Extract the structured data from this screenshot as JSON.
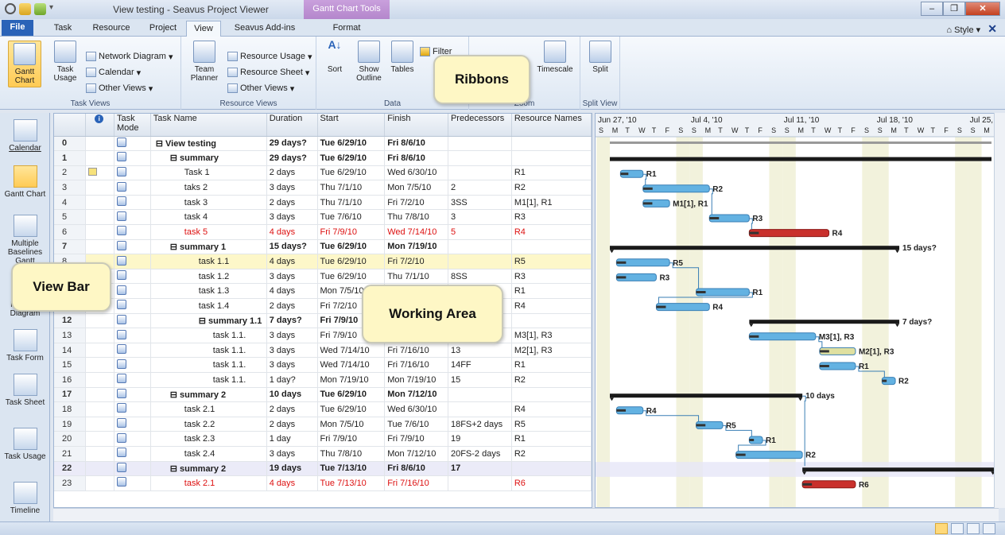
{
  "window": {
    "title": "View testing - Seavus Project Viewer",
    "context_tab": "Gantt Chart Tools",
    "help_label": "Style"
  },
  "tabs": [
    "File",
    "Task",
    "Resource",
    "Project",
    "View",
    "Seavus Add-ins",
    "Format"
  ],
  "ribbon": {
    "groups": [
      {
        "label": "Task Views",
        "big": [
          {
            "label": "Gantt Chart",
            "selected": true
          },
          {
            "label": "Task Usage"
          }
        ],
        "small": [
          "Network Diagram",
          "Calendar",
          "Other Views"
        ]
      },
      {
        "label": "Resource Views",
        "big": [
          {
            "label": "Team Planner"
          }
        ],
        "small": [
          "Resource Usage",
          "Resource Sheet",
          "Other Views"
        ]
      },
      {
        "label": "Data",
        "big": [
          {
            "label": "Sort"
          },
          {
            "label": "Show Outline"
          },
          {
            "label": "Tables"
          }
        ],
        "small": [
          "Filter"
        ]
      },
      {
        "label": "Zoom",
        "big": [
          {
            "label": "Timescale"
          }
        ],
        "small": []
      },
      {
        "label": "Split View",
        "big": [
          {
            "label": "Split"
          }
        ],
        "small": []
      }
    ]
  },
  "view_bar": [
    "Calendar",
    "Gantt Chart",
    "Multiple Baselines Gantt",
    "Network Diagram",
    "Task Form",
    "Task Sheet",
    "Task Usage",
    "Timeline"
  ],
  "columns": [
    "",
    "Task Mode",
    "Task Name",
    "Duration",
    "Start",
    "Finish",
    "Predecessors",
    "Resource Names"
  ],
  "rows": [
    {
      "id": "0",
      "name": "View testing",
      "duration": "29 days?",
      "start": "Tue 6/29/10",
      "finish": "Fri 8/6/10",
      "pred": "",
      "res": "",
      "lvl": 0,
      "summary": true,
      "style": "bold"
    },
    {
      "id": "1",
      "name": "summary",
      "duration": "29 days?",
      "start": "Tue 6/29/10",
      "finish": "Fri 8/6/10",
      "pred": "",
      "res": "",
      "lvl": 1,
      "summary": true
    },
    {
      "id": "2",
      "name": "Task 1",
      "duration": "2 days",
      "start": "Tue 6/29/10",
      "finish": "Wed 6/30/10",
      "pred": "",
      "res": "R1",
      "lvl": 2
    },
    {
      "id": "3",
      "name": "taks 2",
      "duration": "3 days",
      "start": "Thu 7/1/10",
      "finish": "Mon 7/5/10",
      "pred": "2",
      "res": "R2",
      "lvl": 2
    },
    {
      "id": "4",
      "name": "task 3",
      "duration": "2 days",
      "start": "Thu 7/1/10",
      "finish": "Fri 7/2/10",
      "pred": "3SS",
      "res": "M1[1], R1",
      "lvl": 2
    },
    {
      "id": "5",
      "name": "task 4",
      "duration": "3 days",
      "start": "Tue 7/6/10",
      "finish": "Thu 7/8/10",
      "pred": "3",
      "res": "R3",
      "lvl": 2
    },
    {
      "id": "6",
      "name": "task 5",
      "duration": "4 days",
      "start": "Fri 7/9/10",
      "finish": "Wed 7/14/10",
      "pred": "5",
      "res": "R4",
      "lvl": 2,
      "style": "red"
    },
    {
      "id": "7",
      "name": "summary 1",
      "duration": "15 days?",
      "start": "Tue 6/29/10",
      "finish": "Mon 7/19/10",
      "pred": "",
      "res": "",
      "lvl": 1,
      "summary": true
    },
    {
      "id": "8",
      "name": "task 1.1",
      "duration": "4 days",
      "start": "Tue 6/29/10",
      "finish": "Fri 7/2/10",
      "pred": "",
      "res": "R5",
      "lvl": 3,
      "style": "sel"
    },
    {
      "id": "9",
      "name": "task 1.2",
      "duration": "3 days",
      "start": "Tue 6/29/10",
      "finish": "Thu 7/1/10",
      "pred": "8SS",
      "res": "R3",
      "lvl": 3
    },
    {
      "id": "10",
      "name": "task 1.3",
      "duration": "4 days",
      "start": "Mon 7/5/10",
      "finish": "",
      "pred": "",
      "res": "R1",
      "lvl": 3
    },
    {
      "id": "11",
      "name": "task 1.4",
      "duration": "2 days",
      "start": "Fri 7/2/10",
      "finish": "",
      "pred": "",
      "res": "R4",
      "lvl": 3
    },
    {
      "id": "12",
      "name": "summary 1.1",
      "duration": "7 days?",
      "start": "Fri 7/9/10",
      "finish": "",
      "pred": "",
      "res": "",
      "lvl": 3,
      "summary": true
    },
    {
      "id": "13",
      "name": "task 1.1.",
      "duration": "3 days",
      "start": "Fri 7/9/10",
      "finish": "Tue 7/13/10",
      "pred": "",
      "res": "M3[1], R3",
      "lvl": 4
    },
    {
      "id": "14",
      "name": "task 1.1.",
      "duration": "3 days",
      "start": "Wed 7/14/10",
      "finish": "Fri 7/16/10",
      "pred": "13",
      "res": "M2[1], R3",
      "lvl": 4
    },
    {
      "id": "15",
      "name": "task 1.1.",
      "duration": "3 days",
      "start": "Wed 7/14/10",
      "finish": "Fri 7/16/10",
      "pred": "14FF",
      "res": "R1",
      "lvl": 4
    },
    {
      "id": "16",
      "name": "task 1.1.",
      "duration": "1 day?",
      "start": "Mon 7/19/10",
      "finish": "Mon 7/19/10",
      "pred": "15",
      "res": "R2",
      "lvl": 4
    },
    {
      "id": "17",
      "name": "summary 2",
      "duration": "10 days",
      "start": "Tue 6/29/10",
      "finish": "Mon 7/12/10",
      "pred": "",
      "res": "",
      "lvl": 1,
      "summary": true
    },
    {
      "id": "18",
      "name": "task 2.1",
      "duration": "2 days",
      "start": "Tue 6/29/10",
      "finish": "Wed 6/30/10",
      "pred": "",
      "res": "R4",
      "lvl": 2
    },
    {
      "id": "19",
      "name": "task 2.2",
      "duration": "2 days",
      "start": "Mon 7/5/10",
      "finish": "Tue 7/6/10",
      "pred": "18FS+2 days",
      "res": "R5",
      "lvl": 2
    },
    {
      "id": "20",
      "name": "task 2.3",
      "duration": "1 day",
      "start": "Fri 7/9/10",
      "finish": "Fri 7/9/10",
      "pred": "19",
      "res": "R1",
      "lvl": 2
    },
    {
      "id": "21",
      "name": "task 2.4",
      "duration": "3 days",
      "start": "Thu 7/8/10",
      "finish": "Mon 7/12/10",
      "pred": "20FS-2 days",
      "res": "R2",
      "lvl": 2
    },
    {
      "id": "22",
      "name": "summary 2",
      "duration": "19 days",
      "start": "Tue 7/13/10",
      "finish": "Fri 8/6/10",
      "pred": "17",
      "res": "",
      "lvl": 1,
      "summary": true,
      "style": "hl"
    },
    {
      "id": "23",
      "name": "task 2.1",
      "duration": "4 days",
      "start": "Tue 7/13/10",
      "finish": "Fri 7/16/10",
      "pred": "",
      "res": "R6",
      "lvl": 2,
      "style": "red"
    }
  ],
  "gantt": {
    "weeks": [
      "Jun 27, '10",
      "Jul 4, '10",
      "Jul 11, '10",
      "Jul 18, '10",
      "Jul 25,"
    ],
    "days": [
      "S",
      "M",
      "T",
      "W",
      "T",
      "F",
      "S"
    ],
    "bars": [
      {
        "row": 2,
        "start": 0.8,
        "end": 2.5,
        "kind": "task",
        "label": "R1"
      },
      {
        "row": 3,
        "start": 2.5,
        "end": 7.5,
        "kind": "task",
        "label": "R2"
      },
      {
        "row": 4,
        "start": 2.5,
        "end": 4.5,
        "kind": "task",
        "label": "M1[1], R1"
      },
      {
        "row": 5,
        "start": 7.5,
        "end": 10.5,
        "kind": "task",
        "label": "R3"
      },
      {
        "row": 6,
        "start": 10.5,
        "end": 16.5,
        "kind": "crit",
        "label": "R4"
      },
      {
        "row": 7,
        "start": 0,
        "end": 21.8,
        "kind": "summary",
        "label": "15 days?"
      },
      {
        "row": 8,
        "start": 0.5,
        "end": 4.5,
        "kind": "task",
        "label": "R5"
      },
      {
        "row": 9,
        "start": 0.5,
        "end": 3.5,
        "kind": "task",
        "label": "R3"
      },
      {
        "row": 10,
        "start": 6.5,
        "end": 10.5,
        "kind": "task",
        "label": "R1"
      },
      {
        "row": 11,
        "start": 3.5,
        "end": 7.5,
        "kind": "task",
        "label": "R4"
      },
      {
        "row": 12,
        "start": 10.5,
        "end": 21.8,
        "kind": "summary",
        "label": "7 days?"
      },
      {
        "row": 13,
        "start": 10.5,
        "end": 15.5,
        "kind": "task",
        "label": "M3[1], R3"
      },
      {
        "row": 14,
        "start": 15.8,
        "end": 18.5,
        "kind": "manual",
        "label": "M2[1], R3"
      },
      {
        "row": 15,
        "start": 15.8,
        "end": 18.5,
        "kind": "task",
        "label": "R1"
      },
      {
        "row": 16,
        "start": 20.5,
        "end": 21.5,
        "kind": "task",
        "label": "R2"
      },
      {
        "row": 17,
        "start": 0,
        "end": 14.5,
        "kind": "summary",
        "label": "10 days"
      },
      {
        "row": 18,
        "start": 0.5,
        "end": 2.5,
        "kind": "task",
        "label": "R4"
      },
      {
        "row": 19,
        "start": 6.5,
        "end": 8.5,
        "kind": "task",
        "label": "R5"
      },
      {
        "row": 20,
        "start": 10.5,
        "end": 11.5,
        "kind": "task",
        "label": "R1"
      },
      {
        "row": 21,
        "start": 9.5,
        "end": 14.5,
        "kind": "task",
        "label": "R2"
      },
      {
        "row": 22,
        "start": 14.5,
        "end": 29,
        "kind": "summary",
        "label": ""
      },
      {
        "row": 23,
        "start": 14.5,
        "end": 18.5,
        "kind": "crit",
        "label": "R6"
      }
    ]
  },
  "callouts": {
    "ribbons": "Ribbons",
    "view_bar": "View Bar",
    "working_area": "Working Area"
  },
  "colors": {
    "accent": "#2a63b8",
    "critical": "#d11",
    "summary_bar": "#1a1a1a",
    "task_bar": "#4a9fd6"
  }
}
